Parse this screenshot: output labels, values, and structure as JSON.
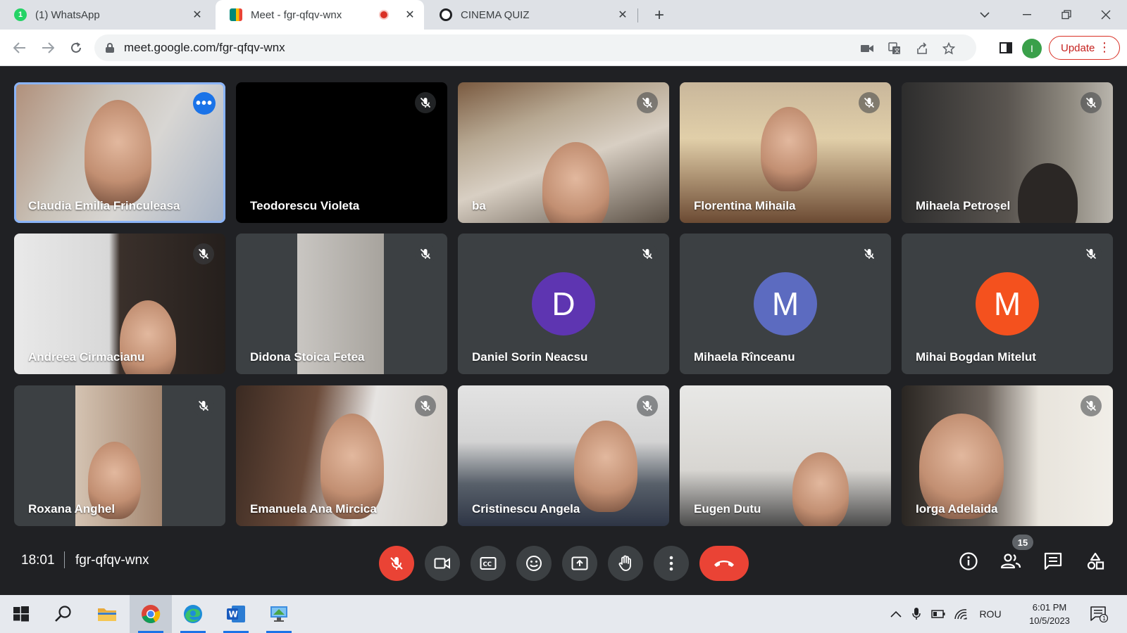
{
  "browser": {
    "tabs": [
      {
        "title": "(1) WhatsApp",
        "favicon_text": "1",
        "favicon_color": "#25d366"
      },
      {
        "title": "Meet - fgr-qfqv-wnx",
        "favicon_text": "",
        "favicon_color": "#00897b"
      },
      {
        "title": "CINEMA QUIZ",
        "favicon_text": "",
        "favicon_color": "#202124"
      }
    ],
    "close_glyph": "✕",
    "new_tab_glyph": "+",
    "url": "meet.google.com/fgr-qfqv-wnx",
    "profile_initial": "I",
    "update_label": "Update"
  },
  "meet": {
    "participants": [
      {
        "name": "Claudia Emilia Frinculeasa"
      },
      {
        "name": "Teodorescu Violeta"
      },
      {
        "name": "ba"
      },
      {
        "name": "Florentina Mihaila"
      },
      {
        "name": "Mihaela Petroșel"
      },
      {
        "name": "Andreea Cirmacianu"
      },
      {
        "name": "Didona Stoica Fetea"
      },
      {
        "name": "Daniel Sorin Neacsu",
        "avatar_letter": "D",
        "avatar_color": "#5e35b1"
      },
      {
        "name": "Mihaela Rînceanu",
        "avatar_letter": "M",
        "avatar_color": "#5c6bc0"
      },
      {
        "name": "Mihai Bogdan Mitelut",
        "avatar_letter": "M",
        "avatar_color": "#f4511e"
      },
      {
        "name": "Roxana Anghel"
      },
      {
        "name": "Emanuela Ana Mircica"
      },
      {
        "name": "Cristinescu Angela"
      },
      {
        "name": "Eugen Dutu"
      },
      {
        "name": "Iorga Adelaida"
      }
    ],
    "time": "18:01",
    "meeting_code": "fgr-qfqv-wnx",
    "people_count": "15",
    "colors": {
      "hangup": "#ea4335",
      "accent": "#1a73e8",
      "bg": "#202124"
    }
  },
  "taskbar": {
    "language": "ROU",
    "time": "6:01 PM",
    "date": "10/5/2023",
    "notification_count": "1"
  }
}
